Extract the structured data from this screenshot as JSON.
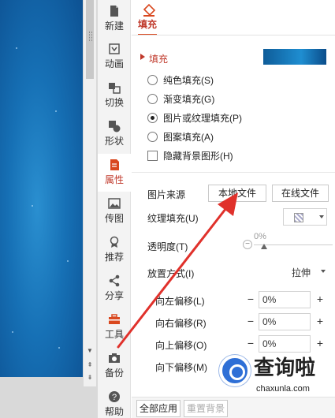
{
  "sidebar": {
    "items": [
      {
        "label": "新建",
        "icon": "new-doc-icon"
      },
      {
        "label": "动画",
        "icon": "animation-icon"
      },
      {
        "label": "切换",
        "icon": "transition-icon"
      },
      {
        "label": "形状",
        "icon": "shape-icon"
      },
      {
        "label": "属性",
        "icon": "properties-icon"
      },
      {
        "label": "传图",
        "icon": "upload-image-icon"
      },
      {
        "label": "推荐",
        "icon": "recommend-icon"
      },
      {
        "label": "分享",
        "icon": "share-icon"
      },
      {
        "label": "工具",
        "icon": "toolbox-icon"
      },
      {
        "label": "备份",
        "icon": "backup-icon"
      },
      {
        "label": "帮助",
        "icon": "help-icon"
      }
    ],
    "active_label": "属性"
  },
  "panel": {
    "tab": "填充",
    "section_title": "填充",
    "fill_options": [
      {
        "label": "纯色填充(S)",
        "checked": false
      },
      {
        "label": "渐变填充(G)",
        "checked": false
      },
      {
        "label": "图片或纹理填充(P)",
        "checked": true
      },
      {
        "label": "图案填充(A)",
        "checked": false
      }
    ],
    "hide_bg_label": "隐藏背景图形(H)",
    "picture_source_label": "图片来源",
    "local_file_button": "本地文件",
    "online_file_button": "在线文件",
    "texture_fill_label": "纹理填充(U)",
    "transparency_label": "透明度(T)",
    "transparency_value": "0%",
    "placement_label": "放置方式(I)",
    "placement_value": "拉伸",
    "offsets": [
      {
        "label": "向左偏移(L)",
        "value": "0%"
      },
      {
        "label": "向右偏移(R)",
        "value": "0%"
      },
      {
        "label": "向上偏移(O)",
        "value": "0%"
      },
      {
        "label": "向下偏移(M)",
        "value": ""
      }
    ],
    "apply_all_button": "全部应用",
    "reset_bg_button": "重置背景"
  },
  "watermark": {
    "text": "查询啦",
    "sub": "chaxunla.com"
  },
  "colors": {
    "accent": "#c0392b",
    "arrow": "#e0312b",
    "slide_blue": "#1670b5"
  }
}
